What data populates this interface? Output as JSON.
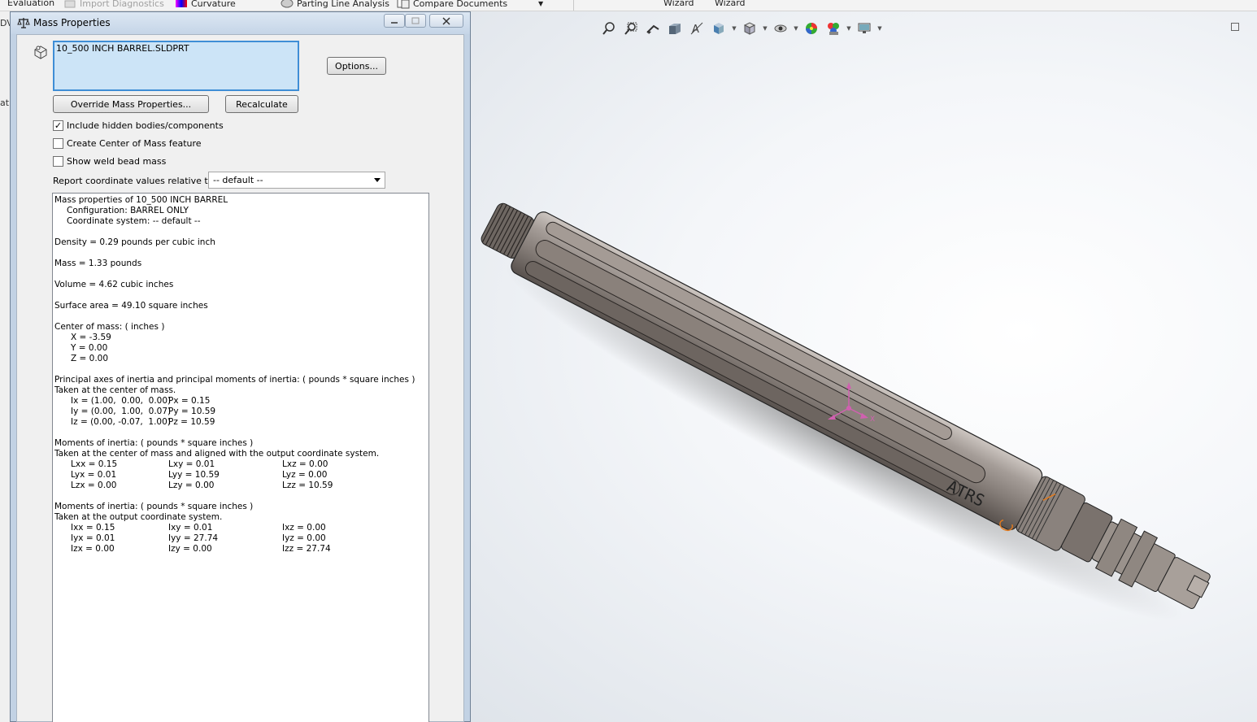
{
  "toolbar": {
    "items": [
      {
        "label": "Evaluation",
        "icon": "none",
        "state": "normal"
      },
      {
        "label": "Import Diagnostics",
        "icon": "diagnostics-icon",
        "state": "disabled"
      },
      {
        "label": "Curvature",
        "icon": "curvature-icon",
        "state": "normal"
      },
      {
        "label": "Parting Line Analysis",
        "icon": "parting-line-icon",
        "state": "normal"
      },
      {
        "label": "Compare Documents",
        "icon": "compare-documents-icon",
        "state": "normal"
      },
      {
        "label": "Wizard",
        "icon": "none",
        "state": "normal"
      },
      {
        "label": "Wizard",
        "icon": "none",
        "state": "normal"
      }
    ]
  },
  "background_app": {
    "fragments": [
      "DV",
      "at"
    ]
  },
  "dialog": {
    "title": "Mass Properties",
    "selected_item": "10_500 INCH BARREL.SLDPRT",
    "options_button": "Options...",
    "override_button": "Override Mass Properties...",
    "recalculate_button": "Recalculate",
    "checkboxes": [
      {
        "label": "Include hidden bodies/components",
        "checked": true
      },
      {
        "label": "Create Center of Mass feature",
        "checked": false
      },
      {
        "label": "Show weld bead mass",
        "checked": false
      }
    ],
    "report_label": "Report coordinate values relative to:",
    "coordinate_system_value": "-- default --",
    "results": {
      "header": "Mass properties of 10_500 INCH BARREL",
      "configuration": "Configuration: BARREL ONLY",
      "coordinate_system": "Coordinate system: -- default --",
      "density": "Density = 0.29 pounds per cubic inch",
      "mass": "Mass = 1.33 pounds",
      "volume": "Volume = 4.62 cubic inches",
      "surface_area": "Surface area = 49.10 square inches",
      "center_of_mass_title": "Center of mass: ( inches )",
      "center_of_mass": [
        "X = -3.59",
        "Y = 0.00",
        "Z = 0.00"
      ],
      "principal_title": "Principal axes of inertia and principal moments of inertia: ( pounds * square inches )",
      "principal_subtitle": "Taken at the center of mass.",
      "principal_rows": [
        [
          "Ix = (1.00,  0.00,  0.00)",
          "Px = 0.15"
        ],
        [
          "Iy = (0.00,  1.00,  0.07)",
          "Py = 10.59"
        ],
        [
          "Iz = (0.00, -0.07,  1.00)",
          "Pz = 10.59"
        ]
      ],
      "moments_com_title": "Moments of inertia: ( pounds * square inches )",
      "moments_com_subtitle": "Taken at the center of mass and aligned with the output coordinate system.",
      "moments_com_rows": [
        [
          "Lxx = 0.15",
          "Lxy = 0.01",
          "Lxz = 0.00"
        ],
        [
          "Lyx = 0.01",
          "Lyy = 10.59",
          "Lyz = 0.00"
        ],
        [
          "Lzx = 0.00",
          "Lzy = 0.00",
          "Lzz = 10.59"
        ]
      ],
      "moments_out_title": "Moments of inertia: ( pounds * square inches )",
      "moments_out_subtitle": "Taken at the output coordinate system.",
      "moments_out_rows": [
        [
          "Ixx = 0.15",
          "Ixy = 0.01",
          "Ixz = 0.00"
        ],
        [
          "Iyx = 0.01",
          "Iyy = 27.74",
          "Iyz = 0.00"
        ],
        [
          "Izx = 0.00",
          "Izy = 0.00",
          "Izz = 27.74"
        ]
      ]
    }
  },
  "viewport": {
    "engraving": "ATRS",
    "triad_axis_label": "X",
    "hud_icons": [
      "zoom-to-fit-icon",
      "zoom-to-area-icon",
      "previous-view-icon",
      "section-view-icon",
      "dynamic-annotation-icon",
      "view-orientation-icon",
      "display-style-icon",
      "hide-show-items-icon",
      "edit-appearance-icon",
      "apply-scene-icon",
      "view-settings-icon"
    ],
    "colors": {
      "barrel": "#8f8681",
      "triad": "#d060b0",
      "highlight": "#e07a20"
    }
  }
}
